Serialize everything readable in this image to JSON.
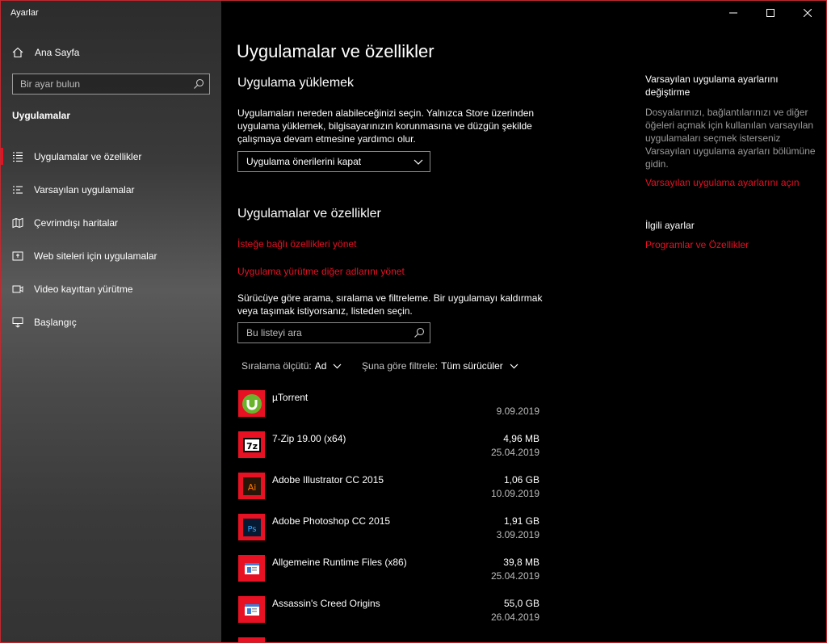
{
  "window": {
    "title": "Ayarlar"
  },
  "sidebar": {
    "home_label": "Ana Sayfa",
    "search_placeholder": "Bir ayar bulun",
    "section_title": "Uygulamalar",
    "items": [
      {
        "label": "Uygulamalar ve özellikler",
        "icon": "apps-list-icon",
        "active": true
      },
      {
        "label": "Varsayılan uygulamalar",
        "icon": "default-apps-icon",
        "active": false
      },
      {
        "label": "Çevrimdışı haritalar",
        "icon": "map-icon",
        "active": false
      },
      {
        "label": "Web siteleri için uygulamalar",
        "icon": "web-apps-icon",
        "active": false
      },
      {
        "label": "Video kayıttan yürütme",
        "icon": "video-icon",
        "active": false
      },
      {
        "label": "Başlangıç",
        "icon": "startup-icon",
        "active": false
      }
    ]
  },
  "main": {
    "page_title": "Uygulamalar ve özellikler",
    "install_heading": "Uygulama yüklemek",
    "install_text": "Uygulamaları nereden alabileceğinizi seçin. Yalnızca Store üzerinden uygulama yüklemek, bilgisayarınızın korunmasına ve düzgün şekilde çalışmaya devam etmesine yardımcı olur.",
    "install_dropdown_value": "Uygulama önerilerini kapat",
    "apps_heading": "Uygulamalar ve özellikler",
    "link_optional": "İsteğe bağlı özellikleri yönet",
    "link_aliases": "Uygulama yürütme diğer adlarını yönet",
    "filter_text": "Sürücüye göre arama, sıralama ve filtreleme. Bir uygulamayı kaldırmak veya taşımak istiyorsanız, listeden seçin.",
    "list_search_placeholder": "Bu listeyi ara",
    "sort_label": "Sıralama ölçütü:",
    "sort_value": "Ad",
    "filter_label": "Şuna göre filtrele:",
    "filter_value": "Tüm sürücüler",
    "apps": [
      {
        "name": "µTorrent",
        "size": "",
        "date": "9.09.2019",
        "icon": "utorrent-icon"
      },
      {
        "name": "7-Zip 19.00 (x64)",
        "size": "4,96 MB",
        "date": "25.04.2019",
        "icon": "7zip-icon"
      },
      {
        "name": "Adobe Illustrator CC 2015",
        "size": "1,06 GB",
        "date": "10.09.2019",
        "icon": "illustrator-icon"
      },
      {
        "name": "Adobe Photoshop CC 2015",
        "size": "1,91 GB",
        "date": "3.09.2019",
        "icon": "photoshop-icon"
      },
      {
        "name": "Allgemeine Runtime Files (x86)",
        "size": "39,8 MB",
        "date": "25.04.2019",
        "icon": "generic-app-icon"
      },
      {
        "name": "Assassin's Creed Origins",
        "size": "55,0 GB",
        "date": "26.04.2019",
        "icon": "generic-app-icon"
      }
    ]
  },
  "right": {
    "default_title": "Varsayılan uygulama ayarlarını değiştirme",
    "default_text": "Dosyalarınızı, bağlantılarınızı ve diğer öğeleri açmak için kullanılan varsayılan uygulamaları seçmek isterseniz Varsayılan uygulama ayarları bölümüne gidin.",
    "default_link": "Varsayılan uygulama ayarlarını açın",
    "related_title": "İlgili ayarlar",
    "related_link": "Programlar ve Özellikler"
  },
  "colors": {
    "accent": "#e81123",
    "border": "#c0292f"
  }
}
